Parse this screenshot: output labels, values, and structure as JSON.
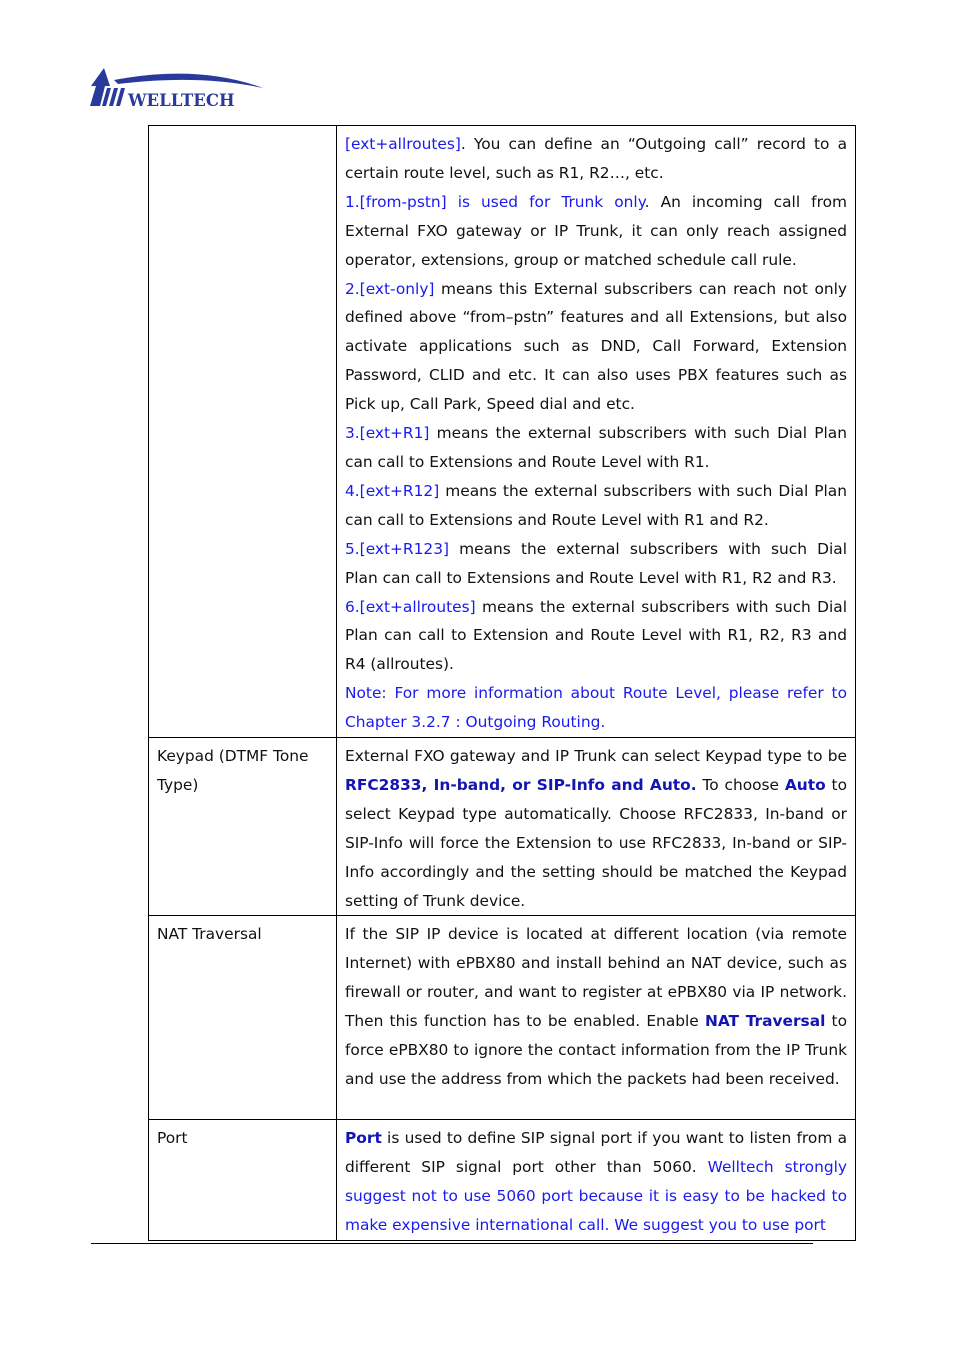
{
  "header": {
    "logo_text": "WELLTECH",
    "logo_color": "#2a3a9a"
  },
  "table": {
    "rows": [
      {
        "label": "",
        "paragraphs": [
          [
            {
              "t": "[ext+allroutes]",
              "s": "blue"
            },
            {
              "t": ". You can define an “Outgoing call” record to a certain route level, such as R1, R2…, etc.",
              "s": ""
            }
          ],
          [
            {
              "t": "1.[from-pstn] is used for Trunk only",
              "s": "blue"
            },
            {
              "t": ". An incoming call from External FXO gateway or IP Trunk, it can only reach assigned operator, extensions, group or matched schedule call rule.",
              "s": ""
            }
          ],
          [
            {
              "t": "2.[ext-only]",
              "s": "blue"
            },
            {
              "t": " means this External subscribers can reach not only defined above “from–pstn” features and all Extensions, but also activate applications such as DND, Call Forward, Extension Password, CLID and etc. It can also uses PBX features such as Pick up, Call Park, Speed dial and etc.",
              "s": ""
            }
          ],
          [
            {
              "t": "3.[ext+R1]",
              "s": "blue"
            },
            {
              "t": " means the external subscribers with such Dial Plan can call to Extensions and Route Level with R1.",
              "s": ""
            }
          ],
          [
            {
              "t": "4.[ext+R12]",
              "s": "blue"
            },
            {
              "t": " means the external subscribers with such Dial Plan can call to Extensions and Route Level with R1 and R2.",
              "s": ""
            }
          ],
          [
            {
              "t": "5.[ext+R123]",
              "s": "blue"
            },
            {
              "t": " means the external subscribers with such Dial Plan can call to Extensions and Route Level with R1, R2 and R3.",
              "s": ""
            }
          ],
          [
            {
              "t": "6.[ext+allroutes]",
              "s": "blue"
            },
            {
              "t": " means the external subscribers with such Dial Plan can call to Extension and Route Level with R1, R2, R3 and R4 (allroutes).",
              "s": ""
            }
          ],
          [
            {
              "t": "Note: For more information about Route Level, please refer to Chapter 3.2.7 : Outgoing Routing.",
              "s": "blue"
            }
          ]
        ]
      },
      {
        "label": "Keypad (DTMF Tone Type)",
        "paragraphs": [
          [
            {
              "t": "External FXO gateway and IP Trunk can select Keypad type to be ",
              "s": ""
            },
            {
              "t": "RFC2833, In-band, or SIP-Info and Auto.",
              "s": "bold-blue"
            },
            {
              "t": " To choose ",
              "s": ""
            },
            {
              "t": "Auto",
              "s": "bold-blue"
            },
            {
              "t": " to select Keypad type automatically. Choose RFC2833, In-band or SIP-Info will force the Extension to use RFC2833, In-band or SIP-Info accordingly and the setting should be matched the Keypad setting of Trunk device.",
              "s": ""
            }
          ]
        ]
      },
      {
        "label": "NAT Traversal",
        "paragraphs": [
          [
            {
              "t": "If the SIP IP device is located at different location (via remote Internet) with ePBX80 and install behind an NAT device, such as firewall or router,  and want to register at ePBX80 via IP network. Then this function has to be enabled. Enable ",
              "s": ""
            },
            {
              "t": "NAT Traversal",
              "s": "bold-blue"
            },
            {
              "t": " to force ePBX80 to ignore the contact information from the IP Trunk and use the address from which the packets had been received.",
              "s": ""
            }
          ]
        ]
      },
      {
        "label": "Port",
        "paragraphs": [
          [
            {
              "t": "Port",
              "s": "bold-blue"
            },
            {
              "t": " is used to define SIP signal port if you want to listen from a different SIP signal port other than 5060. ",
              "s": ""
            },
            {
              "t": "Welltech strongly suggest not to use 5060 port because it is easy to be hacked to make expensive international call. We suggest you to use port",
              "s": "blue"
            }
          ]
        ]
      }
    ]
  }
}
